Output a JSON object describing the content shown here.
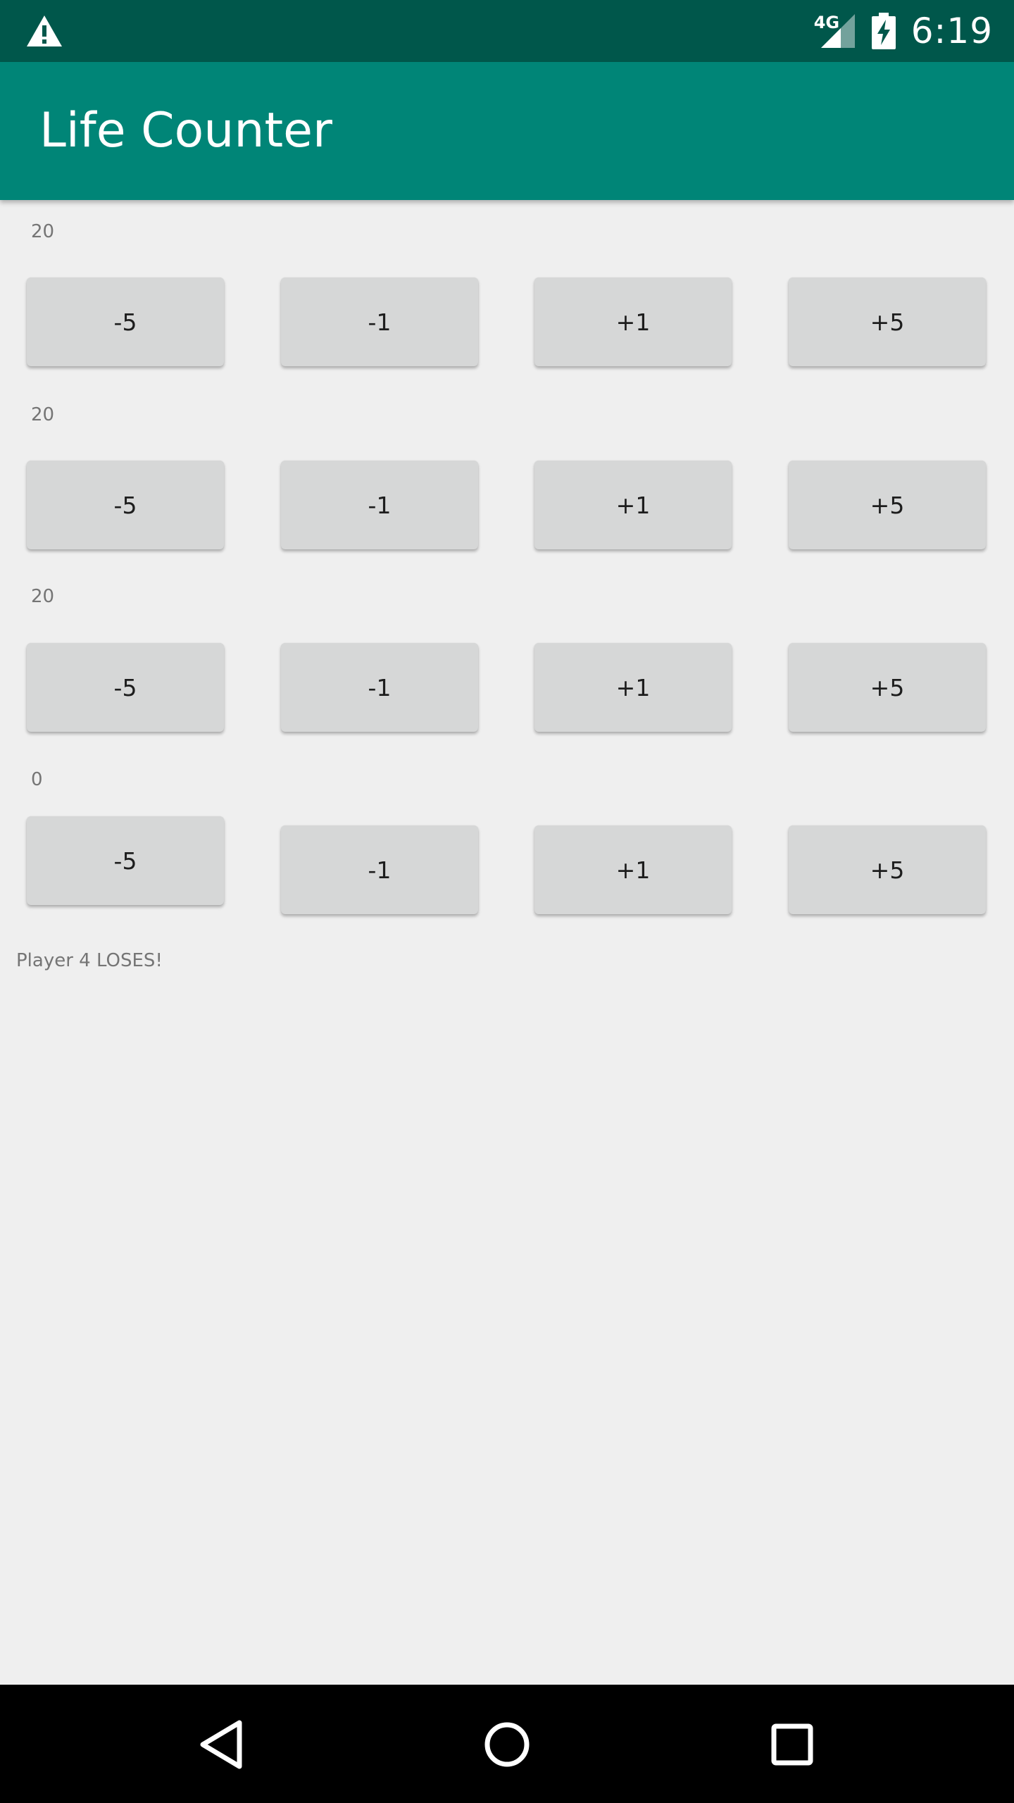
{
  "status_bar": {
    "network": "4G",
    "time": "6:19"
  },
  "app_bar": {
    "title": "Life Counter"
  },
  "players": [
    {
      "life": "20",
      "buttons": [
        "-5",
        "-1",
        "+1",
        "+5"
      ]
    },
    {
      "life": "20",
      "buttons": [
        "-5",
        "-1",
        "+1",
        "+5"
      ]
    },
    {
      "life": "20",
      "buttons": [
        "-5",
        "-1",
        "+1",
        "+5"
      ]
    },
    {
      "life": "0",
      "buttons": [
        "-5",
        "-1",
        "+1",
        "+5"
      ]
    }
  ],
  "status_message": "Player 4 LOSES!",
  "nav_icons": [
    "back-icon",
    "home-icon",
    "recents-icon"
  ],
  "colors": {
    "primary": "#008577",
    "primary_dark": "#00574b",
    "background": "#efefef",
    "button": "#d6d7d7",
    "secondary_text": "#757575"
  }
}
